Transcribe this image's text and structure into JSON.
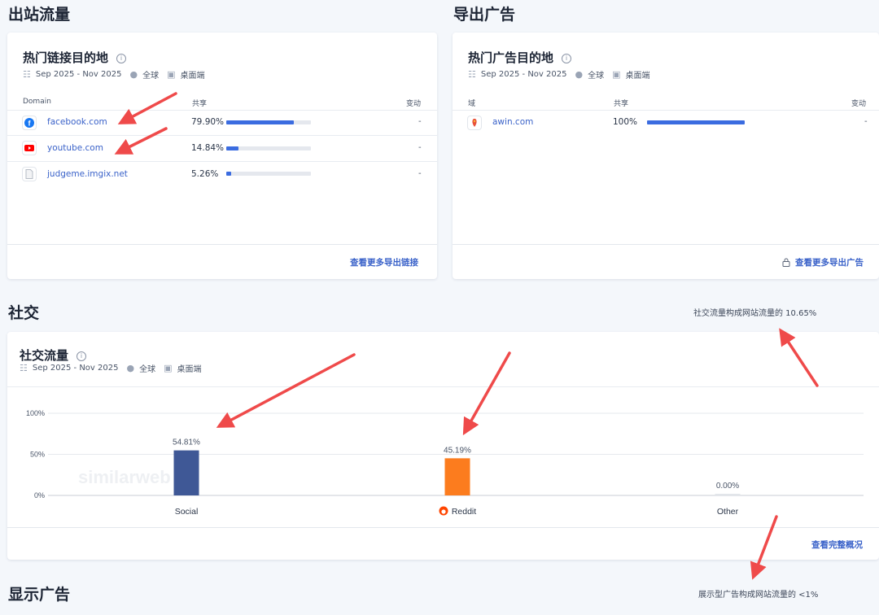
{
  "outbound": {
    "section_title": "出站流量",
    "card_title": "热门链接目的地",
    "date_range": "Sep 2025 - Nov 2025",
    "region": "全球",
    "device": "桌面端",
    "columns": {
      "domain": "Domain",
      "share": "共享",
      "change": "变动"
    },
    "rows": [
      {
        "domain": "facebook.com",
        "share": "79.90%",
        "share_value": 0.799,
        "change": "-",
        "icon": "facebook-icon"
      },
      {
        "domain": "youtube.com",
        "share": "14.84%",
        "share_value": 0.1484,
        "change": "-",
        "icon": "youtube-icon"
      },
      {
        "domain": "judgeme.imgix.net",
        "share": "5.26%",
        "share_value": 0.0526,
        "change": "-",
        "icon": "document-icon"
      }
    ],
    "footer_link": "查看更多导出链接"
  },
  "outgoing_ads": {
    "section_title": "导出广告",
    "card_title": "热门广告目的地",
    "date_range": "Sep 2025 - Nov 2025",
    "region": "全球",
    "device": "桌面端",
    "columns": {
      "domain": "域",
      "share": "共享",
      "change": "变动"
    },
    "rows": [
      {
        "domain": "awin.com",
        "share": "100%",
        "share_value": 1.0,
        "change": "-",
        "icon": "awin-icon"
      }
    ],
    "footer_link": "查看更多导出广告"
  },
  "social": {
    "section_title": "社交",
    "side_note": "社交流量构成网站流量的 10.65%",
    "card_title": "社交流量",
    "date_range": "Sep 2025 - Nov 2025",
    "region": "全球",
    "device": "桌面端",
    "watermark": "similarweb",
    "footer_link": "查看完整概况"
  },
  "display_ads": {
    "section_title": "显示广告",
    "side_note": "展示型广告构成网站流量的 <1%"
  },
  "colors": {
    "link": "#3a62c9",
    "bar": "#3b6ce0",
    "social": "#3f5896",
    "reddit": "#fc7c1e",
    "arrow": "#ef4a4a"
  },
  "chart_data": {
    "type": "bar",
    "categories": [
      "Social",
      "Reddit",
      "Other"
    ],
    "values": [
      54.81,
      45.19,
      0.0
    ],
    "value_labels": [
      "54.81%",
      "45.19%",
      "0.00%"
    ],
    "bar_colors": [
      "#3f5896",
      "#fc7c1e",
      "#e2e5ea"
    ],
    "ylim": [
      0,
      100
    ],
    "yticks": [
      "0%",
      "50%",
      "100%"
    ],
    "grid": true
  }
}
